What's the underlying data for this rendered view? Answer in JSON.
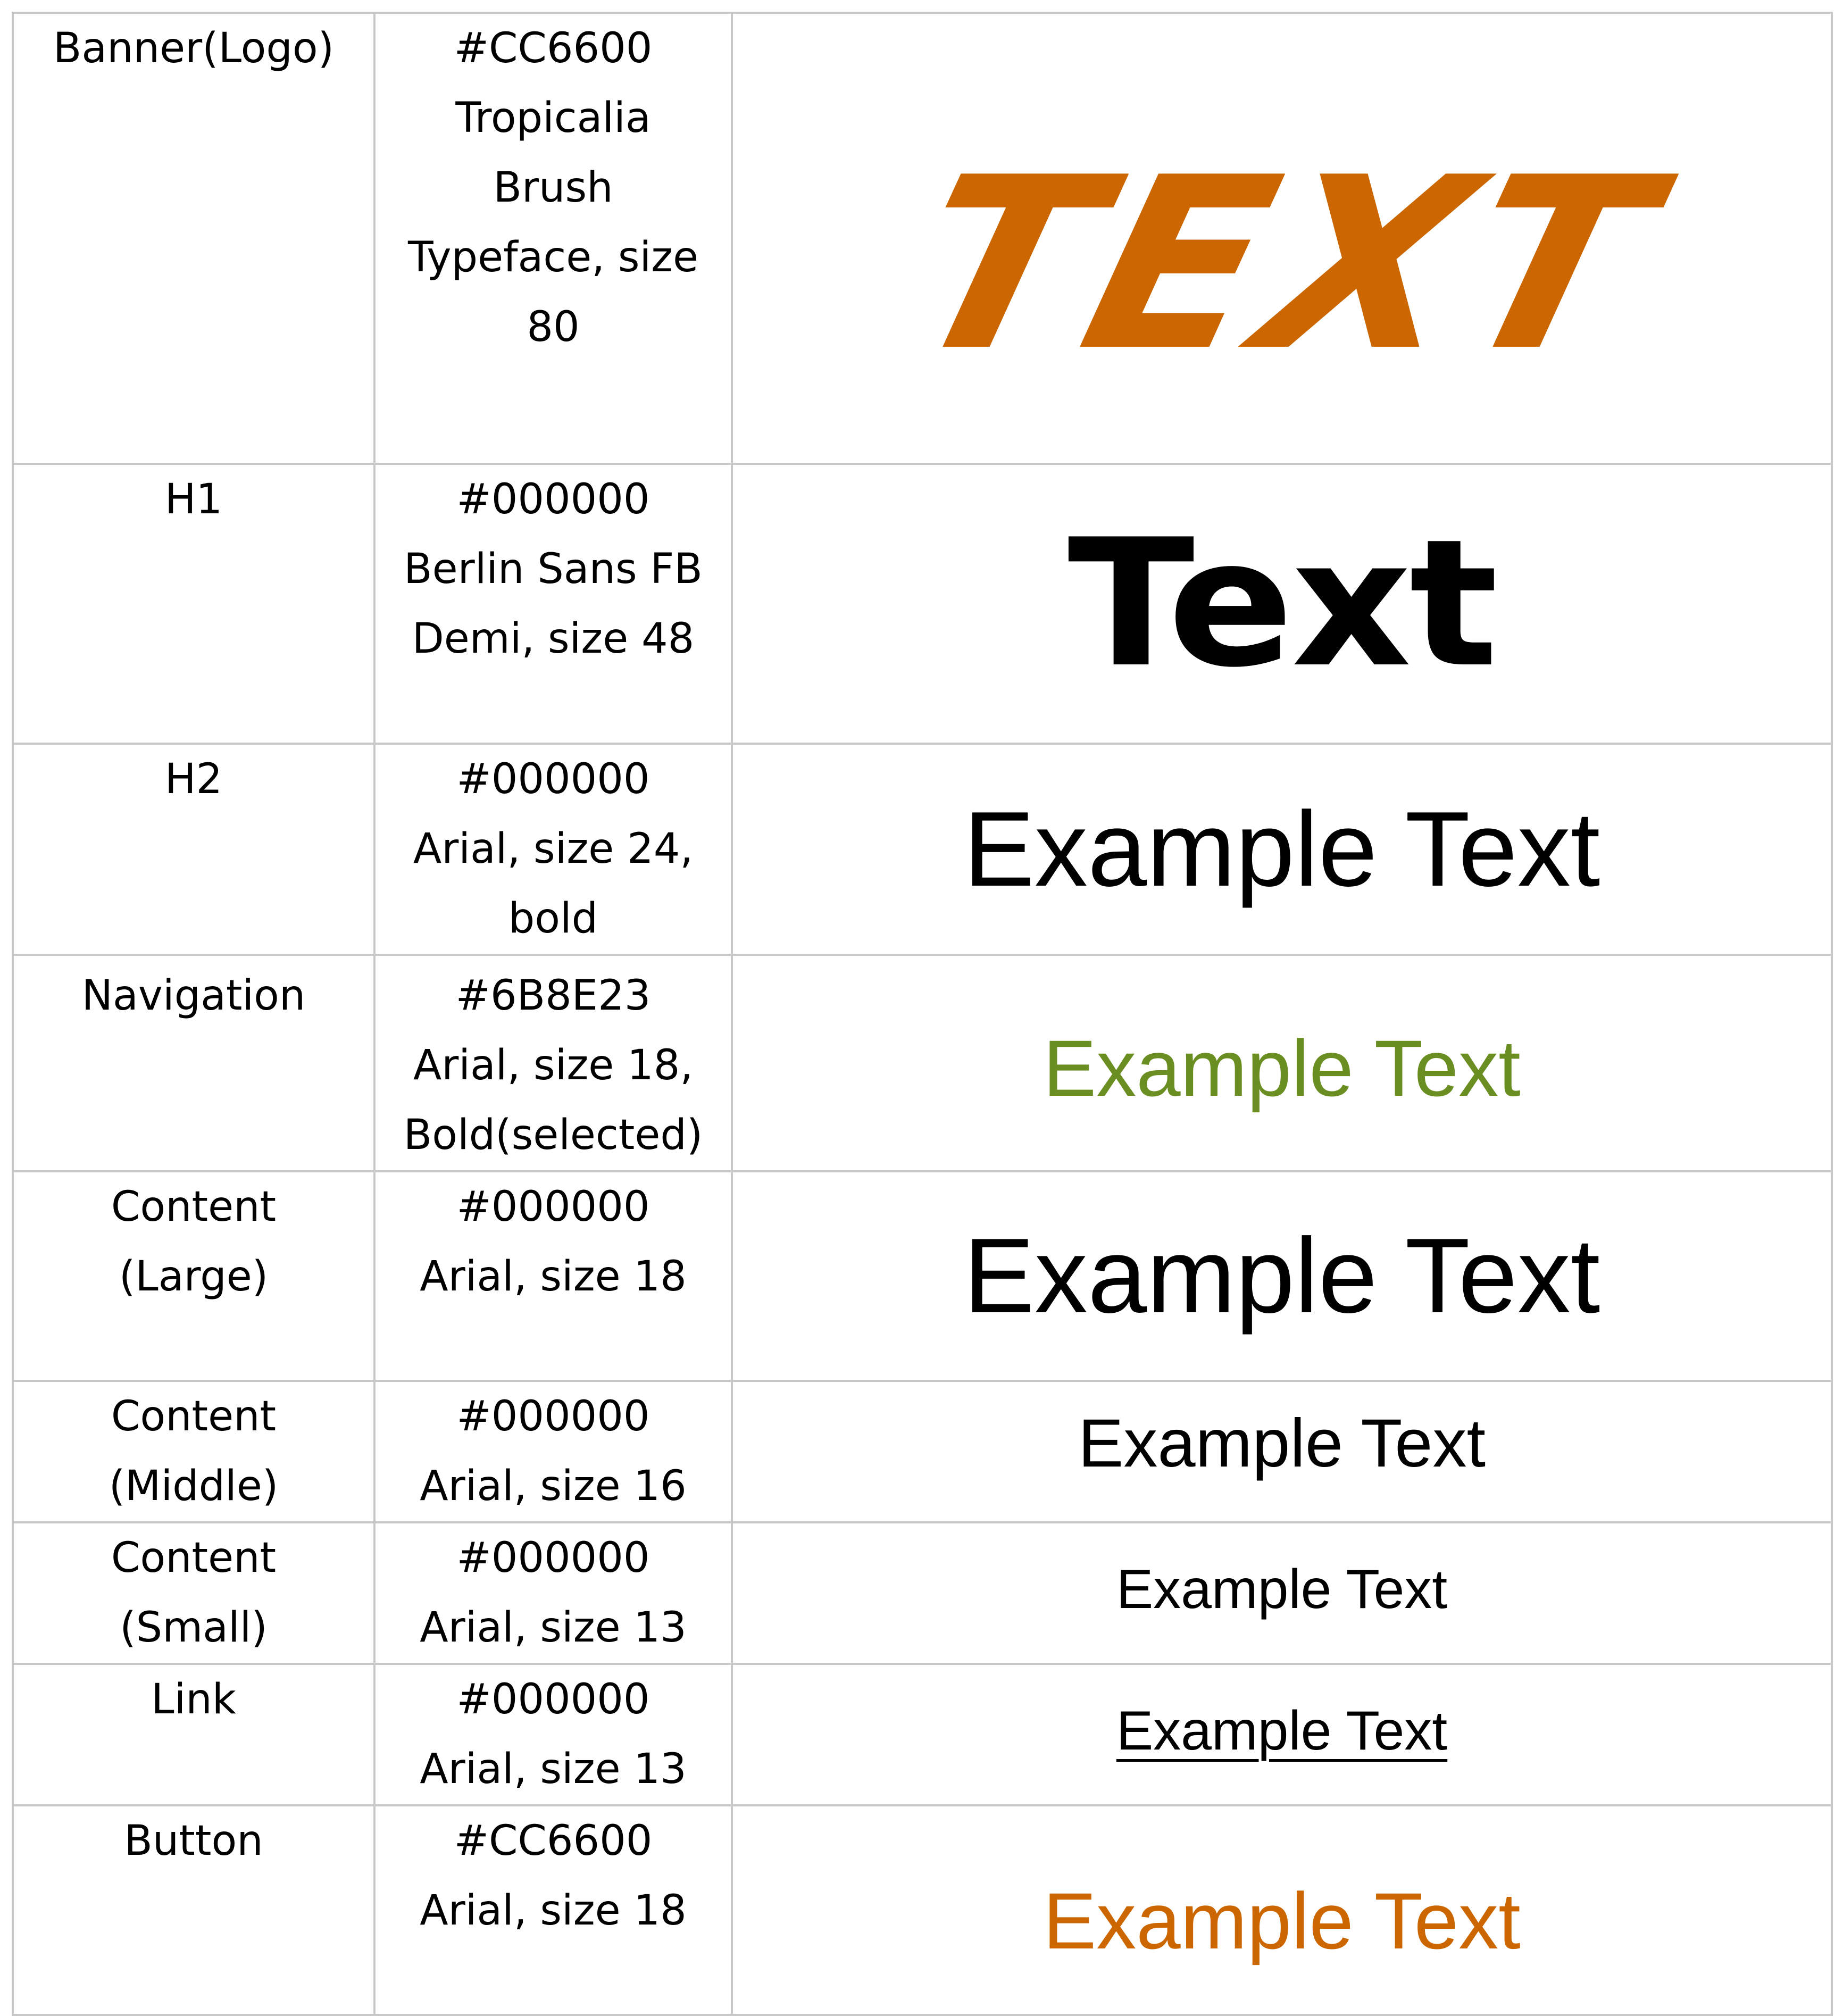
{
  "rows": [
    {
      "label": [
        "Banner(Logo)"
      ],
      "spec": [
        "#CC6600",
        "Tropicalia",
        "Brush",
        "Typeface, size",
        "80"
      ],
      "sample": "TEXT",
      "color": "#CC6600"
    },
    {
      "label": [
        "H1"
      ],
      "spec": [
        "#000000",
        "Berlin Sans FB",
        "Demi, size 48"
      ],
      "sample": "Text",
      "color": "#000000"
    },
    {
      "label": [
        "H2"
      ],
      "spec": [
        "#000000",
        "Arial, size 24,",
        "bold"
      ],
      "sample": "Example Text",
      "color": "#000000"
    },
    {
      "label": [
        "Navigation"
      ],
      "spec": [
        "#6B8E23",
        "Arial, size 18,",
        "Bold(selected)"
      ],
      "sample": "Example Text",
      "color": "#6B8E23"
    },
    {
      "label": [
        "Content",
        "(Large)"
      ],
      "spec": [
        "#000000",
        "Arial, size 18"
      ],
      "sample": "Example Text",
      "color": "#000000"
    },
    {
      "label": [
        "Content",
        "(Middle)"
      ],
      "spec": [
        "#000000",
        "Arial, size 16"
      ],
      "sample": "Example Text",
      "color": "#000000"
    },
    {
      "label": [
        "Content",
        "(Small)"
      ],
      "spec": [
        "#000000",
        "Arial, size 13"
      ],
      "sample": "Example Text",
      "color": "#000000"
    },
    {
      "label": [
        "Link"
      ],
      "spec": [
        "#000000",
        "Arial, size 13"
      ],
      "sample": "Example Text",
      "color": "#000000"
    },
    {
      "label": [
        "Button"
      ],
      "spec": [
        "#CC6600",
        "Arial, size 18"
      ],
      "sample": "Example Text",
      "color": "#CC6600"
    }
  ]
}
